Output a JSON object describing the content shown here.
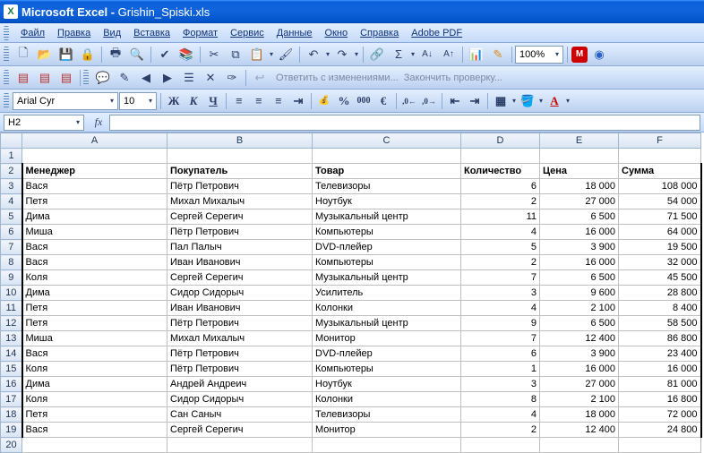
{
  "title_app": "Microsoft Excel",
  "title_file": "Grishin_Spiski.xls",
  "menu": [
    "Файл",
    "Правка",
    "Вид",
    "Вставка",
    "Формат",
    "Сервис",
    "Данные",
    "Окно",
    "Справка",
    "Adobe PDF"
  ],
  "font_name": "Arial Cyr",
  "font_size": "10",
  "zoom": "100%",
  "toolbar3_reply": "Ответить с изменениями...",
  "toolbar3_finish": "Закончить проверку...",
  "name_box": "H2",
  "fx_label": "fx",
  "columns": [
    "A",
    "B",
    "C",
    "D",
    "E",
    "F"
  ],
  "headers": {
    "A": "Менеджер",
    "B": "Покупатель",
    "C": "Товар",
    "D": "Количество",
    "E": "Цена",
    "F": "Сумма"
  },
  "rows": [
    {
      "n": "3",
      "A": "Вася",
      "B": "Пётр Петрович",
      "C": "Телевизоры",
      "D": "6",
      "E": "18 000",
      "F": "108 000"
    },
    {
      "n": "4",
      "A": "Петя",
      "B": "Михал Михалыч",
      "C": "Ноутбук",
      "D": "2",
      "E": "27 000",
      "F": "54 000"
    },
    {
      "n": "5",
      "A": "Дима",
      "B": "Сергей Серегич",
      "C": "Музыкальный центр",
      "D": "11",
      "E": "6 500",
      "F": "71 500"
    },
    {
      "n": "6",
      "A": "Миша",
      "B": "Пётр Петрович",
      "C": "Компьютеры",
      "D": "4",
      "E": "16 000",
      "F": "64 000"
    },
    {
      "n": "7",
      "A": "Вася",
      "B": "Пал Палыч",
      "C": "DVD-плейер",
      "D": "5",
      "E": "3 900",
      "F": "19 500"
    },
    {
      "n": "8",
      "A": "Вася",
      "B": "Иван Иванович",
      "C": "Компьютеры",
      "D": "2",
      "E": "16 000",
      "F": "32 000"
    },
    {
      "n": "9",
      "A": "Коля",
      "B": "Сергей Серегич",
      "C": "Музыкальный центр",
      "D": "7",
      "E": "6 500",
      "F": "45 500"
    },
    {
      "n": "10",
      "A": "Дима",
      "B": "Сидор Сидорыч",
      "C": "Усилитель",
      "D": "3",
      "E": "9 600",
      "F": "28 800"
    },
    {
      "n": "11",
      "A": "Петя",
      "B": "Иван Иванович",
      "C": "Колонки",
      "D": "4",
      "E": "2 100",
      "F": "8 400"
    },
    {
      "n": "12",
      "A": "Петя",
      "B": "Пётр Петрович",
      "C": "Музыкальный центр",
      "D": "9",
      "E": "6 500",
      "F": "58 500"
    },
    {
      "n": "13",
      "A": "Миша",
      "B": "Михал Михалыч",
      "C": "Монитор",
      "D": "7",
      "E": "12 400",
      "F": "86 800"
    },
    {
      "n": "14",
      "A": "Вася",
      "B": "Пётр Петрович",
      "C": "DVD-плейер",
      "D": "6",
      "E": "3 900",
      "F": "23 400"
    },
    {
      "n": "15",
      "A": "Коля",
      "B": "Пётр Петрович",
      "C": "Компьютеры",
      "D": "1",
      "E": "16 000",
      "F": "16 000"
    },
    {
      "n": "16",
      "A": "Дима",
      "B": "Андрей Андреич",
      "C": "Ноутбук",
      "D": "3",
      "E": "27 000",
      "F": "81 000"
    },
    {
      "n": "17",
      "A": "Коля",
      "B": "Сидор Сидорыч",
      "C": "Колонки",
      "D": "8",
      "E": "2 100",
      "F": "16 800"
    },
    {
      "n": "18",
      "A": "Петя",
      "B": "Сан Саныч",
      "C": "Телевизоры",
      "D": "4",
      "E": "18 000",
      "F": "72 000"
    },
    {
      "n": "19",
      "A": "Вася",
      "B": "Сергей Серегич",
      "C": "Монитор",
      "D": "2",
      "E": "12 400",
      "F": "24 800"
    }
  ]
}
